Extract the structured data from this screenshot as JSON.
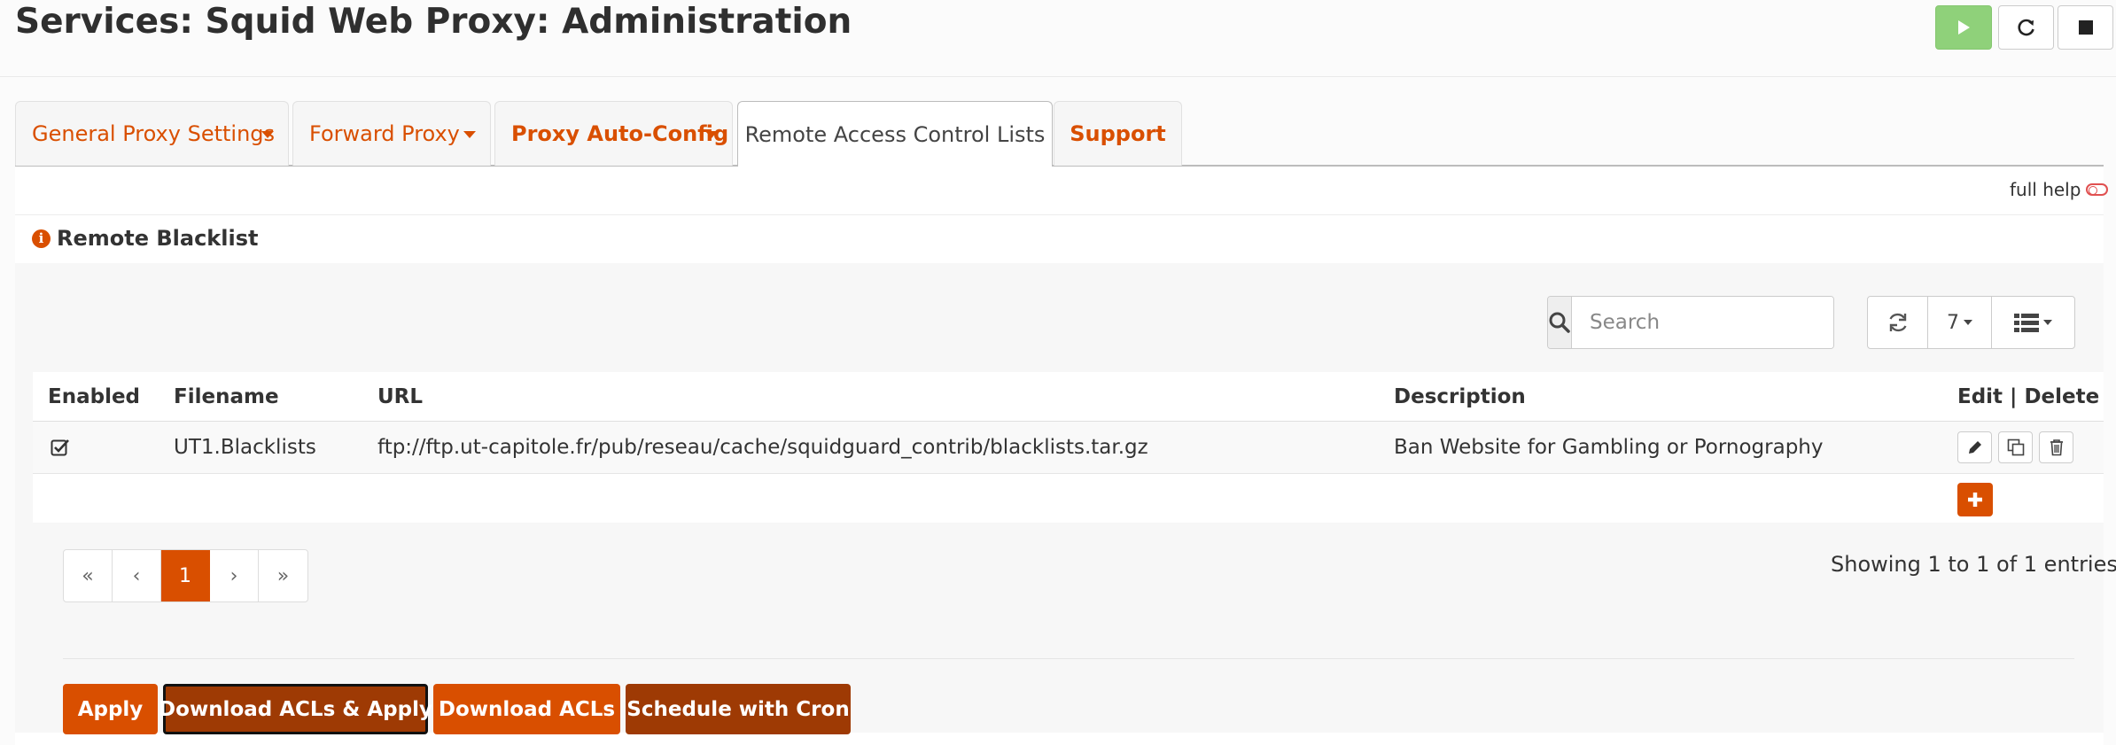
{
  "header": {
    "title": "Services: Squid Web Proxy: Administration"
  },
  "service_controls": [
    {
      "name": "start",
      "icon": "play-icon"
    },
    {
      "name": "restart",
      "icon": "refresh-icon"
    },
    {
      "name": "stop",
      "icon": "stop-icon"
    }
  ],
  "tabs": [
    {
      "label": "General Proxy Settings",
      "dropdown": true,
      "active": false
    },
    {
      "label": "Forward Proxy",
      "dropdown": true,
      "active": false
    },
    {
      "label": "Proxy Auto-Config",
      "dropdown": true,
      "active": false
    },
    {
      "label": "Remote Access Control Lists",
      "dropdown": false,
      "active": true
    },
    {
      "label": "Support",
      "dropdown": false,
      "active": false
    }
  ],
  "help": {
    "label": "full help"
  },
  "section": {
    "title": "Remote Blacklist"
  },
  "search": {
    "placeholder": "Search",
    "value": ""
  },
  "toolbar": {
    "page_size": "7"
  },
  "table": {
    "columns": {
      "enabled": "Enabled",
      "filename": "Filename",
      "url": "URL",
      "description": "Description",
      "commands": "Edit | Delete"
    },
    "rows": [
      {
        "enabled": true,
        "filename": "UT1.Blacklists",
        "url": "ftp://ftp.ut-capitole.fr/pub/reseau/cache/squidguard_contrib/blacklists.tar.gz",
        "description": "Ban Website for Gambling or Pornography"
      }
    ]
  },
  "pagination": {
    "first": "«",
    "prev": "‹",
    "current": "1",
    "next": "›",
    "last": "»"
  },
  "status": {
    "showing": "Showing 1 to 1 of 1 entries"
  },
  "actions": {
    "apply": "Apply",
    "download_apply": "Download ACLs & Apply",
    "download": "Download ACLs",
    "schedule": "Schedule with Cron"
  },
  "colors": {
    "accent": "#d94f00",
    "accent_dark": "#9e3a04",
    "start_green": "#8fd17a"
  }
}
